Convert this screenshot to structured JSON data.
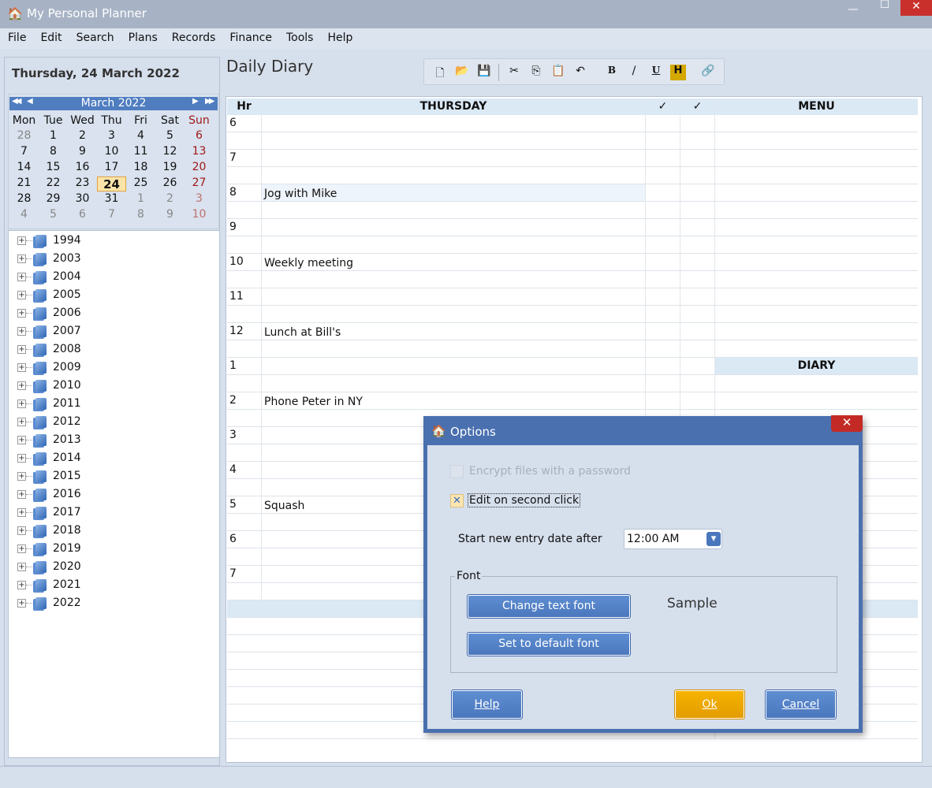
{
  "window": {
    "title": "My Personal Planner",
    "minimize": "—",
    "maximize": "☐",
    "close": "✕"
  },
  "menu": [
    "File",
    "Edit",
    "Search",
    "Plans",
    "Records",
    "Finance",
    "Tools",
    "Help"
  ],
  "sidebar": {
    "date_header": "Thursday, 24 March 2022",
    "calendar": {
      "month_label": "March 2022",
      "nav_first": "◀◀",
      "nav_prev": "◀",
      "nav_next": "▶",
      "nav_last": "▶▶",
      "weekdays": [
        "Mon",
        "Tue",
        "Wed",
        "Thu",
        "Fri",
        "Sat",
        "Sun"
      ],
      "weeks": [
        [
          "28",
          "1",
          "2",
          "3",
          "4",
          "5",
          "6"
        ],
        [
          "7",
          "8",
          "9",
          "10",
          "11",
          "12",
          "13"
        ],
        [
          "14",
          "15",
          "16",
          "17",
          "18",
          "19",
          "20"
        ],
        [
          "21",
          "22",
          "23",
          "24",
          "25",
          "26",
          "27"
        ],
        [
          "28",
          "29",
          "30",
          "31",
          "1",
          "2",
          "3"
        ],
        [
          "4",
          "5",
          "6",
          "7",
          "8",
          "9",
          "10"
        ]
      ],
      "selected": "24"
    },
    "tree": [
      "1994",
      "2003",
      "2004",
      "2005",
      "2006",
      "2007",
      "2008",
      "2009",
      "2010",
      "2011",
      "2012",
      "2013",
      "2014",
      "2015",
      "2016",
      "2017",
      "2018",
      "2019",
      "2020",
      "2021",
      "2022"
    ]
  },
  "main": {
    "title": "Daily Diary",
    "toolbar": [
      {
        "icon": "new-document-icon",
        "glyph": "🗋"
      },
      {
        "icon": "open-folder-icon",
        "glyph": "📂"
      },
      {
        "icon": "save-icon",
        "glyph": "💾"
      },
      {
        "icon": "cut-icon",
        "glyph": "✂"
      },
      {
        "icon": "copy-icon",
        "glyph": "⎘"
      },
      {
        "icon": "paste-icon",
        "glyph": "📋"
      },
      {
        "icon": "undo-icon",
        "glyph": "↶"
      },
      {
        "icon": "bold-icon",
        "glyph": "B"
      },
      {
        "icon": "italic-icon",
        "glyph": "/"
      },
      {
        "icon": "underline-icon",
        "glyph": "U"
      },
      {
        "icon": "highlight-icon",
        "glyph": "H"
      },
      {
        "icon": "link-icon",
        "glyph": "🔗"
      }
    ],
    "grid": {
      "headers": {
        "hr": "Hr",
        "day": "THURSDAY",
        "check1": "✓",
        "check2": "✓",
        "menu": "MENU",
        "diary": "DIARY"
      },
      "hours": [
        {
          "hr": "6",
          "entry": ""
        },
        {
          "hr": "7",
          "entry": ""
        },
        {
          "hr": "8",
          "entry": "Jog with Mike"
        },
        {
          "hr": "9",
          "entry": ""
        },
        {
          "hr": "10",
          "entry": "Weekly meeting"
        },
        {
          "hr": "11",
          "entry": ""
        },
        {
          "hr": "12",
          "entry": "Lunch at Bill's"
        },
        {
          "hr": "1",
          "entry": ""
        },
        {
          "hr": "2",
          "entry": "Phone Peter in NY"
        },
        {
          "hr": "3",
          "entry": ""
        },
        {
          "hr": "4",
          "entry": ""
        },
        {
          "hr": "5",
          "entry": "Squash"
        },
        {
          "hr": "6",
          "entry": ""
        },
        {
          "hr": "7",
          "entry": ""
        }
      ]
    }
  },
  "dialog": {
    "title": "Options",
    "close": "✕",
    "encrypt_label": "Encrypt files with a password",
    "encrypt_checked": false,
    "encrypt_enabled": false,
    "edit_second_click_label": "Edit on second click",
    "edit_second_click_checked": true,
    "check_mark": "✕",
    "start_entry_label": "Start new entry date after",
    "start_entry_value": "12:00 AM",
    "dropdown_arrow": "▾",
    "font_group": "Font",
    "change_font": "Change text font",
    "default_font": "Set to default font",
    "sample": "Sample",
    "help": "Help",
    "ok": "Ok",
    "cancel": "Cancel"
  }
}
